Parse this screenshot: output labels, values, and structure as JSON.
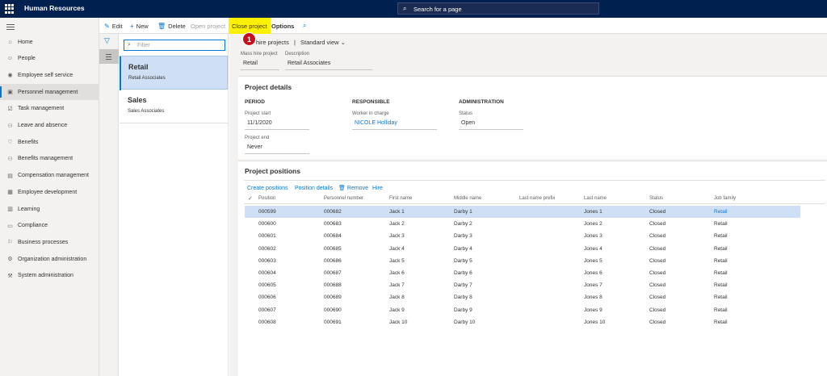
{
  "app": {
    "title": "Human Resources"
  },
  "search": {
    "placeholder": "Search for a page"
  },
  "nav": {
    "items": [
      {
        "icon": "home-icon",
        "glyph": "⌂",
        "label": "Home"
      },
      {
        "icon": "people-icon",
        "glyph": "☺",
        "label": "People"
      },
      {
        "icon": "employee-self-service-icon",
        "glyph": "◉",
        "label": "Employee self service"
      },
      {
        "icon": "personnel-management-icon",
        "glyph": "▣",
        "label": "Personnel management"
      },
      {
        "icon": "task-management-icon",
        "glyph": "☑",
        "label": "Task management"
      },
      {
        "icon": "leave-icon",
        "glyph": "⚇",
        "label": "Leave and absence"
      },
      {
        "icon": "benefits-icon",
        "glyph": "♡",
        "label": "Benefits"
      },
      {
        "icon": "benefits-management-icon",
        "glyph": "⚇",
        "label": "Benefits management"
      },
      {
        "icon": "compensation-icon",
        "glyph": "▤",
        "label": "Compensation management"
      },
      {
        "icon": "employee-development-icon",
        "glyph": "▦",
        "label": "Employee development"
      },
      {
        "icon": "learning-icon",
        "glyph": "▥",
        "label": "Learning"
      },
      {
        "icon": "compliance-icon",
        "glyph": "▭",
        "label": "Compliance"
      },
      {
        "icon": "business-processes-icon",
        "glyph": "⚐",
        "label": "Business processes"
      },
      {
        "icon": "organization-icon",
        "glyph": "⚙",
        "label": "Organization administration"
      },
      {
        "icon": "system-admin-icon",
        "glyph": "⚒",
        "label": "System administration"
      }
    ]
  },
  "actions": {
    "edit": "Edit",
    "new": "New",
    "delete": "Delete",
    "open_project": "Open project",
    "close_project": "Close project",
    "options": "Options"
  },
  "badge": {
    "number": "1"
  },
  "filter": {
    "placeholder": "Filter"
  },
  "list": [
    {
      "title": "Retail",
      "subtitle": "Retail Associates"
    },
    {
      "title": "Sales",
      "subtitle": "Sales Associates"
    }
  ],
  "breadcrumb": {
    "link": "hire projects",
    "separator": "|",
    "view": "Standard view"
  },
  "header": {
    "project_label": "Mass hire project",
    "project_value": "Retail",
    "description_label": "Description",
    "description_value": "Retail Associates"
  },
  "details": {
    "title": "Project details",
    "period": {
      "heading": "PERIOD",
      "start_label": "Project start",
      "start_value": "11/1/2020",
      "end_label": "Project end",
      "end_value": "Never"
    },
    "responsible": {
      "heading": "RESPONSIBLE",
      "worker_label": "Worker in charge",
      "worker_value": "NICOLE Holliday"
    },
    "administration": {
      "heading": "ADMINISTRATION",
      "status_label": "Status",
      "status_value": "Open"
    }
  },
  "positions": {
    "title": "Project positions",
    "actions": {
      "create": "Create positions",
      "details": "Position details",
      "remove": "Remove",
      "hire": "Hire"
    },
    "columns": [
      "Position",
      "Personnel number",
      "First name",
      "Middle name",
      "Last name prefix",
      "Last name",
      "Status",
      "Job family"
    ],
    "rows": [
      [
        "000599",
        "000682",
        "Jack 1",
        "Darby 1",
        "",
        "Jones 1",
        "Closed",
        "Retail"
      ],
      [
        "000600",
        "000683",
        "Jack 2",
        "Darby 2",
        "",
        "Jones 2",
        "Closed",
        "Retail"
      ],
      [
        "000601",
        "000684",
        "Jack 3",
        "Darby 3",
        "",
        "Jones 3",
        "Closed",
        "Retail"
      ],
      [
        "000602",
        "000685",
        "Jack 4",
        "Darby 4",
        "",
        "Jones 4",
        "Closed",
        "Retail"
      ],
      [
        "000603",
        "000686",
        "Jack 5",
        "Darby 5",
        "",
        "Jones 5",
        "Closed",
        "Retail"
      ],
      [
        "000604",
        "000687",
        "Jack 6",
        "Darby 6",
        "",
        "Jones 6",
        "Closed",
        "Retail"
      ],
      [
        "000605",
        "000688",
        "Jack 7",
        "Darby 7",
        "",
        "Jones 7",
        "Closed",
        "Retail"
      ],
      [
        "000606",
        "000689",
        "Jack 8",
        "Darby 8",
        "",
        "Jones 8",
        "Closed",
        "Retail"
      ],
      [
        "000607",
        "000690",
        "Jack 9",
        "Darby 9",
        "",
        "Jones 9",
        "Closed",
        "Retail"
      ],
      [
        "000608",
        "000691",
        "Jack 10",
        "Darby 10",
        "",
        "Jones 10",
        "Closed",
        "Retail"
      ]
    ]
  },
  "colors": {
    "accent": "#0078d4",
    "topbar": "#002050",
    "highlight": "#fff100",
    "badge": "#c50f1f"
  }
}
